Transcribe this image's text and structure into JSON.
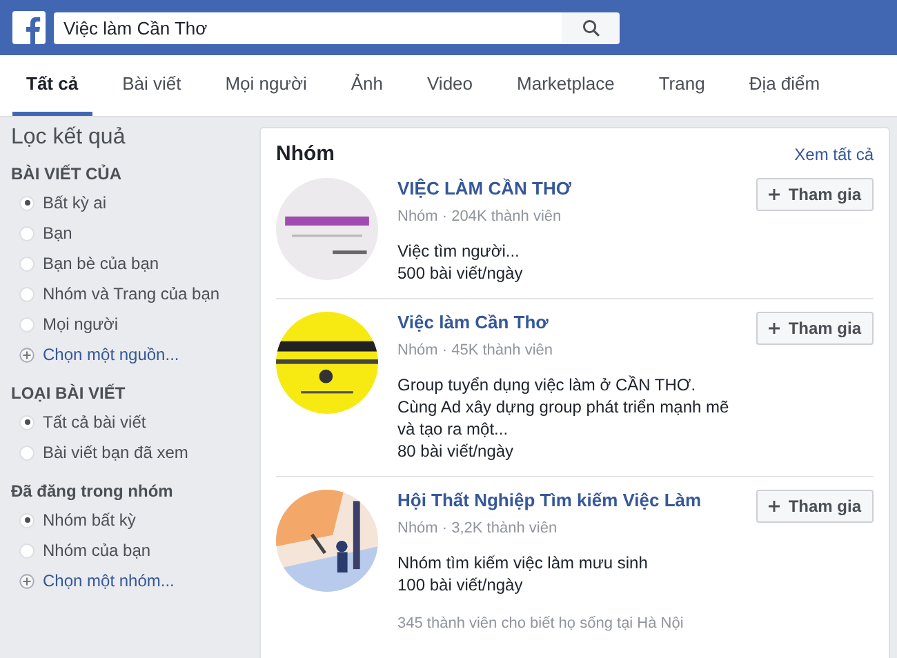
{
  "search": {
    "value": "Việc làm Cần Thơ"
  },
  "tabs": [
    {
      "label": "Tất cả",
      "selected": true
    },
    {
      "label": "Bài viết",
      "selected": false
    },
    {
      "label": "Mọi người",
      "selected": false
    },
    {
      "label": "Ảnh",
      "selected": false
    },
    {
      "label": "Video",
      "selected": false
    },
    {
      "label": "Marketplace",
      "selected": false
    },
    {
      "label": "Trang",
      "selected": false
    },
    {
      "label": "Địa điểm",
      "selected": false
    }
  ],
  "sidebar": {
    "title": "Lọc kết quả",
    "sections": [
      {
        "heading": "BÀI VIẾT CỦA",
        "options": [
          {
            "label": "Bất kỳ ai",
            "selected": true
          },
          {
            "label": "Bạn",
            "selected": false
          },
          {
            "label": "Bạn bè của bạn",
            "selected": false
          },
          {
            "label": "Nhóm và Trang của bạn",
            "selected": false
          },
          {
            "label": "Mọi người",
            "selected": false
          }
        ],
        "add_link": "Chọn một nguồn..."
      },
      {
        "heading": "LOẠI BÀI VIẾT",
        "options": [
          {
            "label": "Tất cả bài viết",
            "selected": true
          },
          {
            "label": "Bài viết bạn đã xem",
            "selected": false
          }
        ]
      },
      {
        "heading": "Đã đăng trong nhóm",
        "options": [
          {
            "label": "Nhóm bất kỳ",
            "selected": true
          },
          {
            "label": "Nhóm của bạn",
            "selected": false
          }
        ],
        "add_link": "Chọn một nhóm..."
      }
    ]
  },
  "groups": {
    "title": "Nhóm",
    "see_all": "Xem tất cả",
    "items": [
      {
        "name": "VIỆC LÀM CẦN THƠ",
        "meta": "Nhóm · 204K thành viên",
        "description": "Việc tìm người...",
        "rate": "500 bài viết/ngày",
        "join": "Tham gia"
      },
      {
        "name": "Việc làm Cần Thơ",
        "meta": "Nhóm · 45K thành viên",
        "description": "Group tuyển dụng việc làm ở CẦN THƠ. Cùng Ad xây dựng group phát triển mạnh mẽ và tạo ra một...",
        "rate": "80 bài viết/ngày",
        "join": "Tham gia"
      },
      {
        "name": "Hội Thất Nghiệp Tìm kiếm Việc Làm",
        "meta": "Nhóm · 3,2K thành viên",
        "description": "Nhóm tìm kiếm việc làm mưu sinh",
        "rate": "100 bài viết/ngày",
        "join": "Tham gia",
        "note": "345 thành viên cho biết họ sống tại Hà Nội"
      }
    ]
  }
}
